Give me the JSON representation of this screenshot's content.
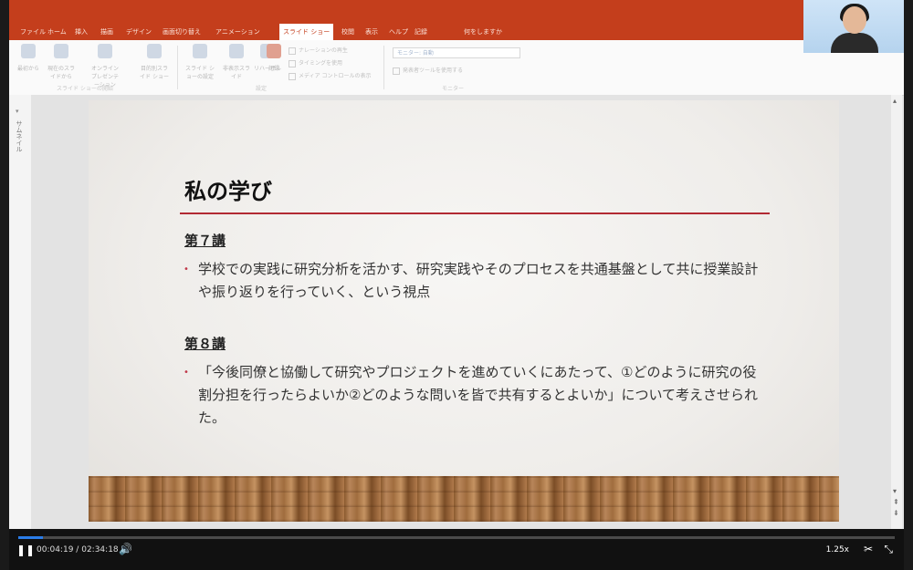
{
  "ribbon": {
    "tabs": [
      "ファイル",
      "ホーム",
      "挿入",
      "描画",
      "デザイン",
      "画面切り替え",
      "アニメーション",
      "スライド ショー",
      "校閲",
      "表示",
      "ヘルプ",
      "記録",
      "何をしますか"
    ],
    "active_tab": "スライド ショー",
    "buttons": [
      "最初から",
      "現在のスライドから",
      "オンライン プレゼンテーション",
      "目的別スライド ショー",
      "スライド ショーの設定",
      "非表示スライド",
      "リハーサル",
      "記録"
    ],
    "checkboxes": [
      "ナレーションの再生",
      "タイミングを使用",
      "メディア コントロールの表示"
    ],
    "field_text": "モニター: 自動",
    "presenter_view": "発表者ツールを使用する",
    "groups": [
      "スライド ショーの開始",
      "設定",
      "モニター"
    ]
  },
  "left_pane": {
    "label": "サムネイル"
  },
  "slide": {
    "title": "私の学び",
    "sections": [
      {
        "heading": "第７講",
        "text": "学校での実践に研究分析を活かす、研究実践やそのプロセスを共通基盤として共に授業設計や振り返りを行っていく、という視点"
      },
      {
        "heading": "第８講",
        "text": "「今後同僚と協働して研究やプロジェクトを進めていくにあたって、①どのように研究の役割分担を行ったらよいか②どのような問いを皆で共有するとよいか」について考えさせられた。"
      }
    ],
    "bullet": "•"
  },
  "player": {
    "current_time": "00:04:19",
    "separator": "/",
    "total_time": "02:34:18",
    "progress": 0.028,
    "speed": "1.25x",
    "pause_icon": "pause-icon",
    "volume_icon": "volume-icon",
    "clip_icon": "scissors-icon",
    "exit_fullscreen_icon": "exit-fullscreen-icon"
  },
  "colors": {
    "accent": "#c43e1c",
    "title_rule": "#b22a33",
    "progress": "#2b7de9"
  }
}
